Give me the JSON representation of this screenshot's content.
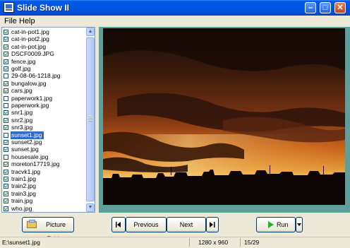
{
  "window": {
    "title": "Slide Show II"
  },
  "menu": [
    "File",
    "Help"
  ],
  "files": [
    {
      "name": "cat-in-pot1.jpg",
      "checked": true
    },
    {
      "name": "cat-in-pot2.jpg",
      "checked": true
    },
    {
      "name": "cat-in-pot.jpg",
      "checked": true
    },
    {
      "name": "DSCF0009.JPG",
      "checked": true
    },
    {
      "name": "fence.jpg",
      "checked": true
    },
    {
      "name": "golf.jpg",
      "checked": true
    },
    {
      "name": "29-08-06-1218.jpg",
      "checked": false
    },
    {
      "name": "bungalow.jpg",
      "checked": true
    },
    {
      "name": "cars.jpg",
      "checked": true
    },
    {
      "name": "paperwork1.jpg",
      "checked": false
    },
    {
      "name": "paperwork.jpg",
      "checked": false
    },
    {
      "name": "snr1.jpg",
      "checked": true
    },
    {
      "name": "snr2.jpg",
      "checked": true
    },
    {
      "name": "snr3.jpg",
      "checked": true
    },
    {
      "name": "sunset1.jpg",
      "checked": false,
      "selected": true
    },
    {
      "name": "sunset2.jpg",
      "checked": true
    },
    {
      "name": "sunset.jpg",
      "checked": true
    },
    {
      "name": "housesale.jpg",
      "checked": false
    },
    {
      "name": "moreton17719.jpg",
      "checked": true
    },
    {
      "name": "tracvk1.jpg",
      "checked": true
    },
    {
      "name": "train1.jpg",
      "checked": true
    },
    {
      "name": "train2.jpg",
      "checked": true
    },
    {
      "name": "train3.jpg",
      "checked": true
    },
    {
      "name": "train.jpg",
      "checked": true
    },
    {
      "name": "who.jpg",
      "checked": true
    }
  ],
  "buttons": {
    "picture_folder": "Picture Folder",
    "previous": "Previous",
    "next": "Next",
    "run": "Run"
  },
  "status": {
    "path": "E:\\sunset1.jpg",
    "dimensions": "1280 x 960",
    "position": "15/29"
  },
  "icons": {
    "first": "first-icon",
    "last": "last-icon",
    "play": "play-icon",
    "dropdown": "dropdown-arrow-icon",
    "folder": "folder-icon"
  }
}
